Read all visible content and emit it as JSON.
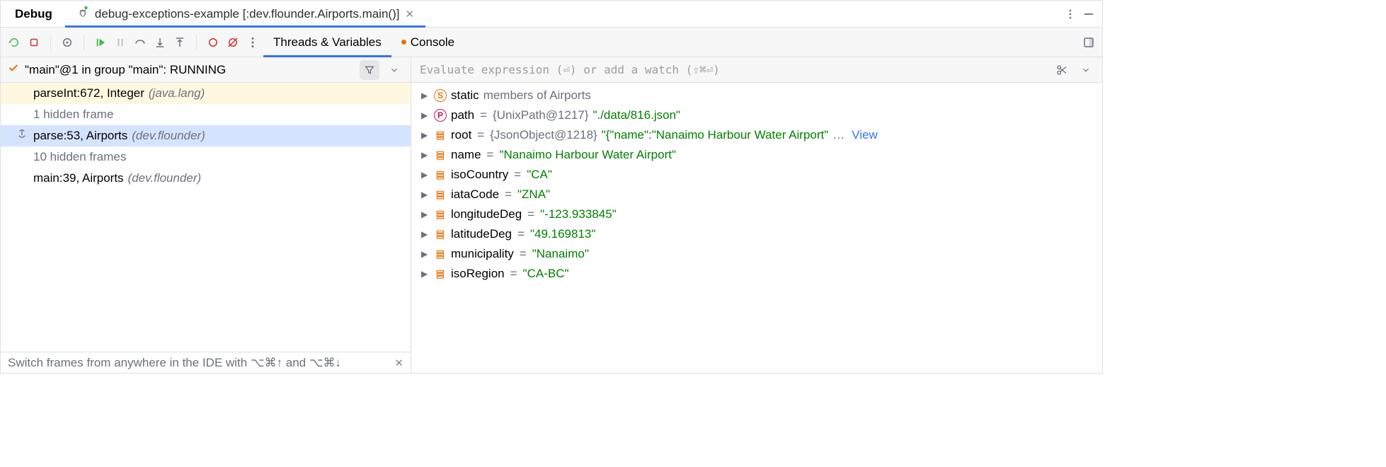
{
  "panel_title": "Debug",
  "run_config": {
    "icon": "bug-icon",
    "label": "debug-exceptions-example [:dev.flounder.Airports.main()]"
  },
  "content_tabs": {
    "threads": "Threads & Variables",
    "console": "Console",
    "active_index": 0
  },
  "thread_status": "\"main\"@1 in group \"main\": RUNNING",
  "frames": [
    {
      "kind": "highlight",
      "method": "parseInt:672, Integer",
      "pkg": "(java.lang)"
    },
    {
      "kind": "hidden",
      "text": "1 hidden frame"
    },
    {
      "kind": "selected",
      "method": "parse:53, Airports",
      "pkg": "(dev.flounder)",
      "drop_icon": true
    },
    {
      "kind": "hidden",
      "text": "10 hidden frames"
    },
    {
      "kind": "normal",
      "method": "main:39, Airports",
      "pkg": "(dev.flounder)"
    }
  ],
  "tip": "Switch frames from anywhere in the IDE with ⌥⌘↑ and ⌥⌘↓",
  "eval_placeholder": "Evaluate expression (⏎) or add a watch (⇧⌘⏎)",
  "variables": [
    {
      "icon": "static",
      "name": "static",
      "grey_after": " members of Airports"
    },
    {
      "icon": "prop",
      "name": "path",
      "type": "{UnixPath@1217}",
      "value": "\"./data/816.json\""
    },
    {
      "icon": "field",
      "name": "root",
      "type": "{JsonObject@1218}",
      "value": "\"{\"name\":\"Nanaimo Harbour Water Airport\"",
      "truncated": true,
      "view": "View"
    },
    {
      "icon": "field",
      "name": "name",
      "value": "\"Nanaimo Harbour Water Airport\""
    },
    {
      "icon": "field",
      "name": "isoCountry",
      "value": "\"CA\""
    },
    {
      "icon": "field",
      "name": "iataCode",
      "value": "\"ZNA\""
    },
    {
      "icon": "field",
      "name": "longitudeDeg",
      "value": "\"-123.933845\""
    },
    {
      "icon": "field",
      "name": "latitudeDeg",
      "value": "\"49.169813\""
    },
    {
      "icon": "field",
      "name": "municipality",
      "value": "\"Nanaimo\""
    },
    {
      "icon": "field",
      "name": "isoRegion",
      "value": "\"CA-BC\""
    }
  ]
}
